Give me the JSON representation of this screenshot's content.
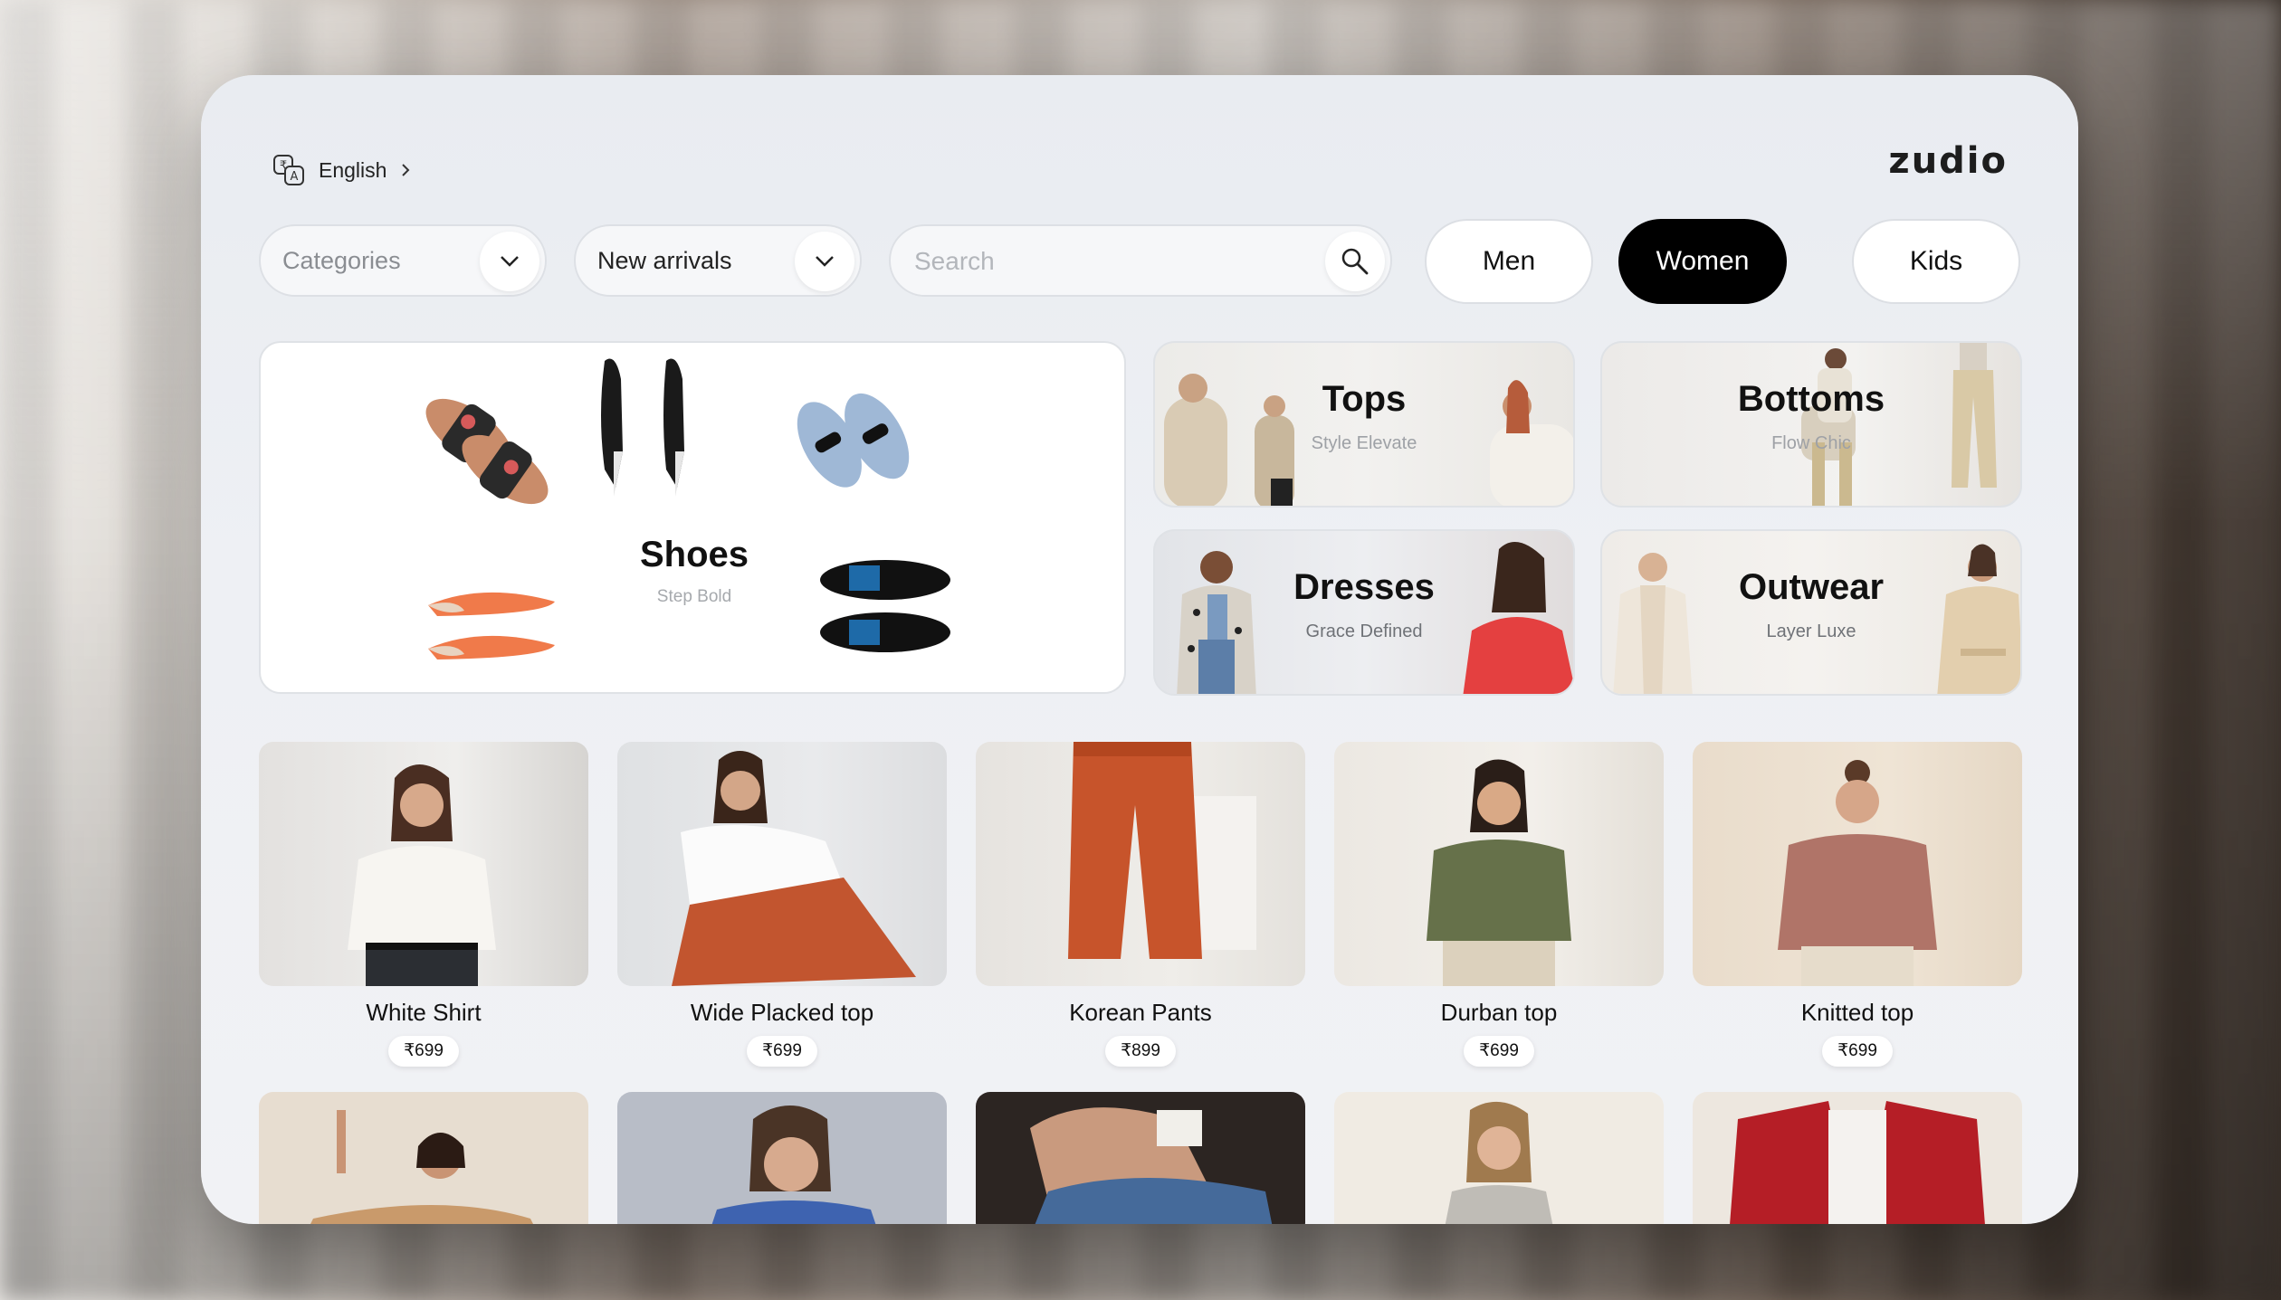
{
  "header": {
    "language": "English",
    "brand": "zudio"
  },
  "filters": {
    "categories_placeholder": "Categories",
    "sort_value": "New arrivals",
    "search_placeholder": "Search"
  },
  "segments": [
    {
      "label": "Men",
      "active": false
    },
    {
      "label": "Women",
      "active": true
    },
    {
      "label": "Kids",
      "active": false
    }
  ],
  "categories": {
    "shoes": {
      "title": "Shoes",
      "subtitle": "Step Bold"
    },
    "tops": {
      "title": "Tops",
      "subtitle": "Style Elevate"
    },
    "bottoms": {
      "title": "Bottoms",
      "subtitle": "Flow Chic"
    },
    "dresses": {
      "title": "Dresses",
      "subtitle": "Grace Defined"
    },
    "outwear": {
      "title": "Outwear",
      "subtitle": "Layer Luxe"
    }
  },
  "products": [
    {
      "name": "White Shirt",
      "price": "₹699"
    },
    {
      "name": "Wide Placked top",
      "price": "₹699"
    },
    {
      "name": "Korean Pants",
      "price": "₹899"
    },
    {
      "name": "Durban top",
      "price": "₹699"
    },
    {
      "name": "Knitted top",
      "price": "₹699"
    }
  ],
  "colors": {
    "accent": "#000000",
    "panel": "#eef0f4"
  }
}
